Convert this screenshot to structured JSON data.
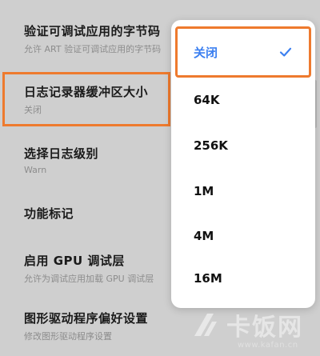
{
  "settings": {
    "items": [
      {
        "title": "验证可调试应用的字节码",
        "subtitle": "允许 ART 验证可调试应用的字节码"
      },
      {
        "title": "日志记录器缓冲区大小",
        "subtitle": "关闭"
      },
      {
        "title": "选择日志级别",
        "subtitle": "Warn"
      },
      {
        "title": "功能标记",
        "subtitle": ""
      },
      {
        "title": "启用 GPU 调试层",
        "subtitle": "允许为调试应用加载 GPU 调试层"
      },
      {
        "title": "图形驱动程序偏好设置",
        "subtitle": "修改图形驱动程序设置"
      }
    ]
  },
  "popup": {
    "options": [
      {
        "label": "关闭",
        "selected": true
      },
      {
        "label": "64K",
        "selected": false
      },
      {
        "label": "256K",
        "selected": false
      },
      {
        "label": "1M",
        "selected": false
      },
      {
        "label": "4M",
        "selected": false
      },
      {
        "label": "16M",
        "selected": false
      }
    ],
    "selected_icon": "checkmark-icon",
    "accent_color": "#3b7ff0"
  },
  "highlight_color": "#ee7a2e",
  "watermark": {
    "text": "卡饭网",
    "url": "www.kafan.cn",
    "icon": "kafan-logo-icon"
  }
}
